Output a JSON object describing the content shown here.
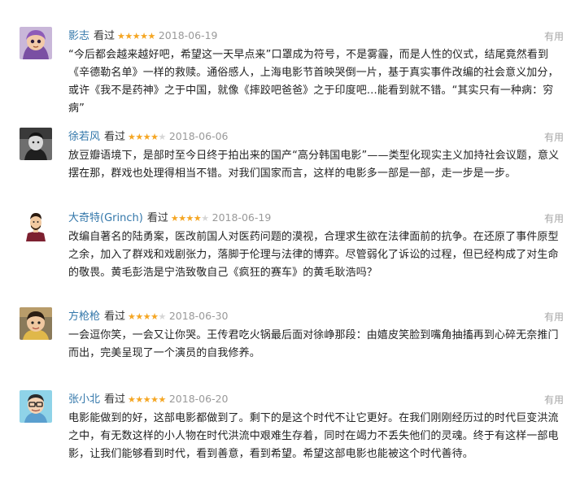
{
  "useful_label": "有用",
  "watched_label": "看过",
  "star_color": "#f5a623",
  "username_color": "#3377aa",
  "reviews": [
    {
      "avatar_icon": "cartoon-girl-avatar",
      "username": "影志",
      "rating": 5,
      "stars_text": "★★★★★",
      "stars_off": "",
      "date": "2018-06-19",
      "text": "“今后都会越来越好吧，希望这一天早点来”口罩成为符号，不是雾霾，而是人性的仪式，结尾竟然看到《辛德勒名单》一样的救赎。通俗感人，上海电影节首映哭倒一片，基于真实事件改编的社会意义加分，或许《我不是药神》之于中国，就像《摔跤吧爸爸》之于印度吧…能看到就不错。“其实只有一种病：穷病”"
    },
    {
      "avatar_icon": "bw-photo-avatar",
      "username": "徐若风",
      "rating": 4,
      "stars_text": "★★★★",
      "stars_off": "★",
      "date": "2018-06-06",
      "text": "放豆瓣语境下，是部时至今日终于拍出来的国产“高分韩国电影”——类型化现实主义加持社会议题，意义摆在那，群戏也处理得相当不错。对我们国家而言，这样的电影多一部是一部，走一步是一步。"
    },
    {
      "avatar_icon": "cartoon-man-avatar",
      "username": "大奇特(Grinch)",
      "rating": 4,
      "stars_text": "★★★★",
      "stars_off": "★",
      "date": "2018-06-19",
      "text": "改编自著名的陆勇案，医改前国人对医药问题的漠视，合理求生欲在法律面前的抗争。在还原了事件原型之余，加入了群戏和戏剧张力，落脚于伦理与法律的博弈。尽管弱化了诉讼的过程，但已经构成了对生命的敬畏。黄毛彭浩是宁浩致敬自己《疯狂的赛车》的黄毛耿浩吗？"
    },
    {
      "avatar_icon": "child-photo-avatar",
      "username": "方枪枪",
      "rating": 4,
      "stars_text": "★★★★",
      "stars_off": "★",
      "date": "2018-06-30",
      "text": "一会逗你笑，一会又让你哭。王传君吃火锅最后面对徐峥那段：由嬉皮笑脸到嘴角抽搐再到心碎无奈推门而出，完美呈现了一个演员的自我修养。"
    },
    {
      "avatar_icon": "glasses-man-avatar",
      "username": "张小北",
      "rating": 5,
      "stars_text": "★★★★★",
      "stars_off": "",
      "date": "2018-06-20",
      "text": "电影能做到的好，这部电影都做到了。剩下的是这个时代不让它更好。在我们刚刚经历过的时代巨变洪流之中，有无数这样的小人物在时代洪流中艰难生存着，同时在竭力不丢失他们的灵魂。终于有这样一部电影，让我们能够看到时代，看到善意，看到希望。希望这部电影也能被这个时代善待。"
    }
  ]
}
